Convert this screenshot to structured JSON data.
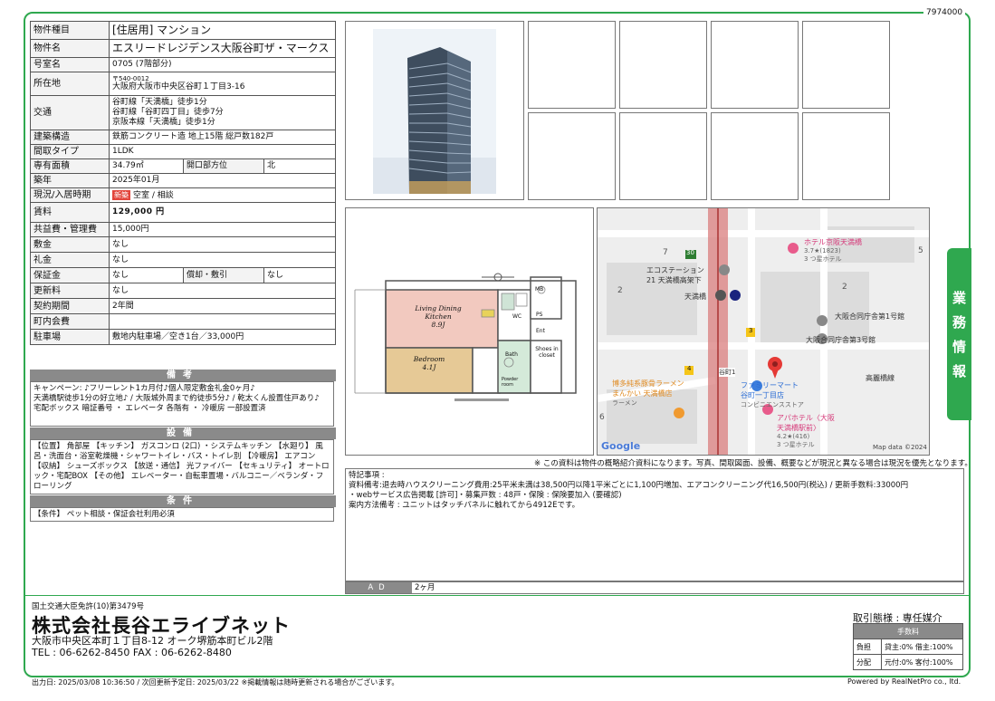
{
  "doc_id": "7974000",
  "side_tab": "業務情報",
  "spec": {
    "type_label": "物件種目",
    "type_value": "[住居用] マンション",
    "name_label": "物件名",
    "name_value": "エスリードレジデンス大阪谷町ザ・マークス",
    "room_label": "号室名",
    "room_value": "0705 (7階部分)",
    "address_label": "所在地",
    "address_zip": "〒540-0012",
    "address_value": "大阪府大阪市中央区谷町１丁目3-16",
    "transit_label": "交通",
    "transit_1": "谷町線「天満橋」徒歩1分",
    "transit_2": "谷町線「谷町四丁目」徒歩7分",
    "transit_3": "京阪本線「天満橋」徒歩1分",
    "structure_label": "建築構造",
    "structure_value": "鉄筋コンクリート造 地上15階 総戸数182戸",
    "layout_label": "間取タイプ",
    "layout_value": "1LDK",
    "area_label": "専有面積",
    "area_value": "34.79㎡",
    "direction_label": "開口部方位",
    "direction_value": "北",
    "built_label": "築年",
    "built_value": "2025年01月",
    "status_label": "現況/入居時期",
    "status_badge": "新築",
    "status_value": "空室 / 相談",
    "rent_label": "賃料",
    "rent_value": "129,000 円",
    "fee_label": "共益費・管理費",
    "fee_value": "15,000円",
    "deposit_label": "敷金",
    "deposit_value": "なし",
    "key_label": "礼金",
    "key_value": "なし",
    "security_label": "保証金",
    "security_value": "なし",
    "amort_label": "償却・敷引",
    "amort_value": "なし",
    "renew_label": "更新料",
    "renew_value": "なし",
    "contract_label": "契約期間",
    "contract_value": "2年間",
    "town_label": "町内会費",
    "town_value": "",
    "parking_label": "駐車場",
    "parking_value": "敷地内駐車場／空き1台／33,000円"
  },
  "remarks": {
    "title": "備考",
    "text": "キャンペーン: ♪フリーレント1カ月付♪個人限定敷金礼金0ヶ月♪\n天満橋駅徒歩1分の好立地♪ / 大阪城外周まで約徒歩5分♪ / 乾太くん設置住戸あり♪\n宅配ボックス 暗証番号 ・ エレベータ 各階有 ・ 冷暖房 一部設置済"
  },
  "equipment": {
    "title": "設備",
    "text": "【位置】 角部屋 【キッチン】 ガスコンロ (2口) ・システムキッチン 【水廻り】 風呂・洗面台・浴室乾燥機・シャワートイレ・バス・トイレ別 【冷暖房】 エアコン 【収納】 シューズボックス 【放送・通信】 光ファイバー 【セキュリティ】 オートロック・宅配BOX 【その他】 エレベーター・自転車置場・バルコニー／ベランダ・フローリング"
  },
  "conditions": {
    "title": "条件",
    "text": "【条件】 ペット相談・保証会社利用必須"
  },
  "floorplan": {
    "ldk_label": "Living Dining Kitchen",
    "ldk_size": "8.9J",
    "bed_label": "Bedroom",
    "bed_size": "4.1J",
    "wc": "WC",
    "bath": "Bath",
    "powder": "Powder room",
    "shoes": "Shoes in closet",
    "ent": "Ent",
    "ms": "MB",
    "ps": "PS"
  },
  "map": {
    "ecostation": "エコステーション",
    "ecostation_2": "21 天満橋高架下",
    "tenmabashi": "天満橋",
    "hotel_top": "ホテル京阪天満橋",
    "hotel_top_rating": "3.7★(1823)",
    "hotel_top_type": "3 つ星ホテル",
    "gov1": "大阪合同庁舎第1号館",
    "gov3": "大阪合同庁舎第3号館",
    "koraibashi": "高麗橋線",
    "tanimachi1": "谷町1",
    "ramen_1": "博多純系豚骨ラーメン",
    "ramen_2": "まんかい 天満橋店",
    "ramen_3": "ラーメン",
    "family_1": "ファミリーマート",
    "family_2": "谷町一丁目店",
    "family_3": "コンビニエンスストア",
    "apa_1": "アパホテル〈大阪",
    "apa_2": "天満橋駅前〉",
    "apa_rating": "4.2★(416)",
    "apa_type": "3 つ星ホテル",
    "route_30": "30",
    "route_3": "3",
    "route_4": "4",
    "num_7": "7",
    "num_2a": "2",
    "num_2b": "2",
    "num_5": "5",
    "num_6": "6",
    "google": "Google",
    "mapdata": "Map data ©2024"
  },
  "disclaimer": "※ この資料は物件の概略紹介資料になります。写真、間取図面、設備、概要などが現況と異なる場合は現況を優先となります。",
  "notes": {
    "title": "特記事項 :",
    "line1": "資料備考:退去時ハウスクリーニング費用:25平米未満は38,500円以降1平米ごとに1,100円増加、エアコンクリーニング代16,500円(税込) / 更新手数料:33000円",
    "line2": "・webサービス広告掲載 [許可]・募集戸数 : 48戸・保険 : 保険要加入 (要確認)",
    "line3": "案内方法備考 : ユニットはタッチパネルに触れてから4912Eです。"
  },
  "ad": {
    "label": "AD",
    "value": "2ヶ月"
  },
  "company": {
    "license": "国土交通大臣免許(10)第3479号",
    "name": "株式会社長谷エライブネット",
    "address": "大阪市中央区本町１丁目8-12 オーク堺筋本町ビル2階",
    "tel": "TEL : 06-6262-8450   FAX : 06-6262-8480"
  },
  "trade": {
    "title": "取引態様 : 専任媒介",
    "fee_head": "手数料",
    "row1_label": "負担",
    "row1_value": "貸主:0% 借主:100%",
    "row2_label": "分配",
    "row2_value": "元付:0% 客付:100%"
  },
  "footer": {
    "left": "出力日: 2025/03/08 10:36:50 / 次回更新予定日: 2025/03/22 ※掲載情報は随時更新される場合がございます。",
    "right": "Powered by RealNetPro co., ltd."
  },
  "colors": {
    "accent_green": "#2fa84f",
    "header_gray": "#8a8a8a",
    "badge_red": "#e2453c",
    "map_pin": "#e53935"
  }
}
